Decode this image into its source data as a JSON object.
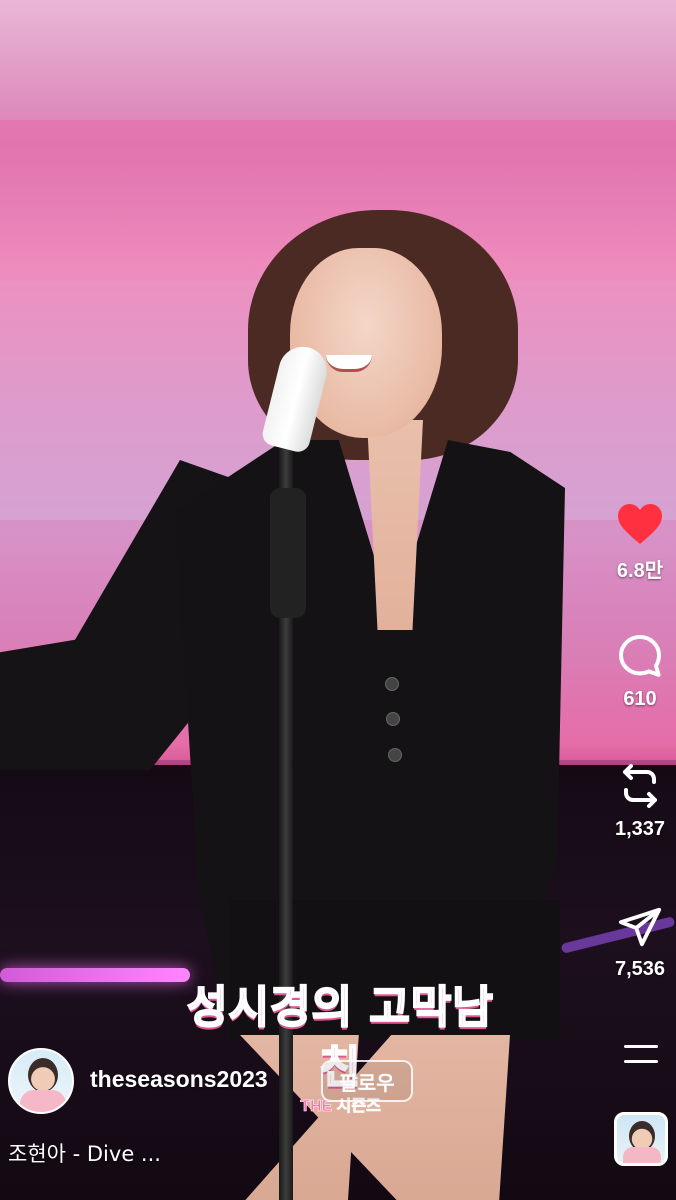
{
  "video": {
    "overlay_logo": {
      "title": "성시경의 고막남친",
      "subtitle": "THE 시즌즈"
    }
  },
  "actions": {
    "like": {
      "icon": "heart-icon",
      "count": "6.8만",
      "color": "#ff3040",
      "liked": true
    },
    "comment": {
      "icon": "comment-icon",
      "count": "610"
    },
    "repost": {
      "icon": "repost-icon",
      "count": "1,337"
    },
    "share": {
      "icon": "send-icon",
      "count": "7,536"
    },
    "more": {
      "icon": "more-icon"
    },
    "audio": {
      "icon": "audio-cover-thumbnail"
    }
  },
  "author": {
    "username": "theseasons2023",
    "follow_label": "팔로우"
  },
  "audio": {
    "track_label": "조현아 - Dive ..."
  }
}
